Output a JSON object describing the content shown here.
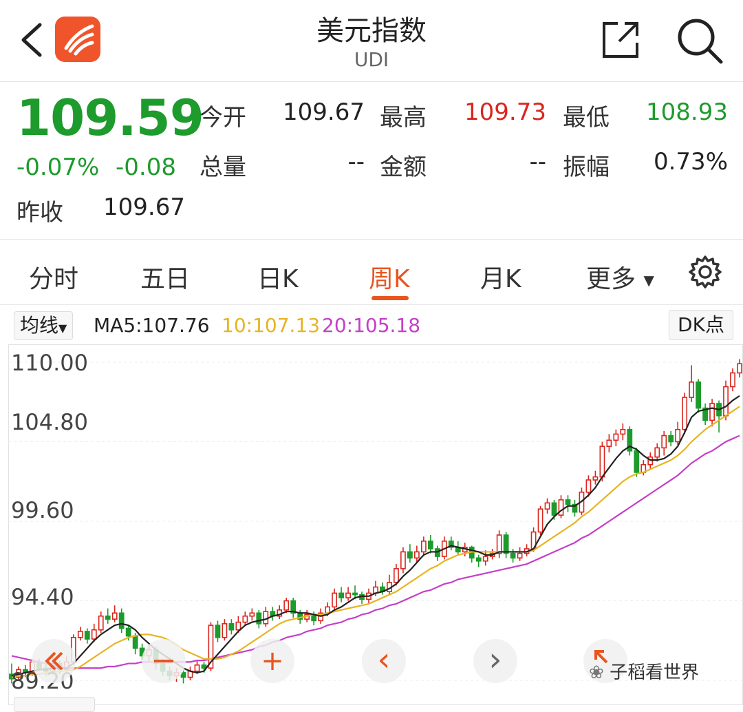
{
  "header": {
    "title": "美元指数",
    "subtitle": "UDI",
    "icons": [
      "back-icon",
      "app-logo",
      "share-icon",
      "search-icon"
    ]
  },
  "quote": {
    "price": "109.59",
    "change_pct": "-0.07%",
    "change": "-0.08",
    "prev_close_label": "昨收",
    "prev_close": "109.67",
    "open_label": "今开",
    "open": "109.67",
    "high_label": "最高",
    "high": "109.73",
    "low_label": "最低",
    "low": "108.93",
    "volume_label": "总量",
    "volume": "--",
    "amount_label": "金额",
    "amount": "--",
    "amplitude_label": "振幅",
    "amplitude": "0.73%",
    "colors": {
      "down": "#1d9b2c",
      "up": "#d9251d"
    }
  },
  "tabs": {
    "items": [
      "分时",
      "五日",
      "日K",
      "周K",
      "月K",
      "更多"
    ],
    "active": "周K"
  },
  "ma": {
    "selector_label": "均线",
    "ma5": "MA5:107.76",
    "ma10": "10:107.13",
    "ma20": "20:105.18",
    "dk_button": "DK点",
    "colors": {
      "ma5": "#222222",
      "ma10": "#e6b422",
      "ma20": "#c43fc7"
    }
  },
  "chart_data": {
    "type": "candlestick",
    "yticks": [
      "110.00",
      "104.80",
      "99.60",
      "94.40",
      "89.20"
    ],
    "ylim": [
      89.2,
      110.0
    ],
    "candles": [
      [
        89.6,
        89.3,
        90.3,
        89.0
      ],
      [
        89.4,
        89.9,
        90.1,
        89.2
      ],
      [
        89.9,
        89.7,
        90.2,
        89.4
      ],
      [
        89.7,
        90.4,
        90.6,
        89.5
      ],
      [
        90.4,
        90.0,
        90.6,
        89.8
      ],
      [
        90.0,
        89.8,
        90.3,
        89.5
      ],
      [
        89.8,
        90.3,
        90.7,
        89.6
      ],
      [
        90.3,
        89.9,
        90.5,
        89.6
      ],
      [
        89.9,
        90.4,
        90.8,
        89.7
      ],
      [
        90.4,
        92.0,
        92.2,
        90.2
      ],
      [
        92.0,
        92.4,
        92.7,
        91.8
      ],
      [
        92.4,
        91.9,
        92.6,
        91.6
      ],
      [
        91.9,
        92.5,
        92.9,
        91.7
      ],
      [
        92.5,
        93.4,
        93.7,
        92.3
      ],
      [
        93.4,
        93.2,
        93.9,
        92.9
      ],
      [
        93.2,
        93.6,
        94.1,
        93.0
      ],
      [
        93.6,
        92.6,
        93.9,
        92.3
      ],
      [
        92.6,
        92.1,
        92.8,
        91.8
      ],
      [
        92.1,
        91.3,
        92.3,
        90.9
      ],
      [
        91.3,
        90.8,
        91.6,
        90.5
      ],
      [
        90.8,
        91.2,
        91.5,
        90.4
      ],
      [
        91.2,
        90.3,
        91.4,
        89.9
      ],
      [
        90.3,
        89.8,
        90.6,
        89.5
      ],
      [
        89.8,
        89.5,
        90.1,
        89.2
      ],
      [
        89.5,
        89.7,
        90.0,
        89.1
      ],
      [
        89.7,
        89.4,
        89.9,
        89.0
      ],
      [
        89.4,
        89.8,
        90.1,
        89.2
      ],
      [
        89.8,
        90.2,
        90.5,
        89.6
      ],
      [
        90.2,
        90.0,
        90.4,
        89.7
      ],
      [
        90.0,
        92.8,
        93.0,
        89.8
      ],
      [
        92.8,
        92.0,
        93.1,
        91.7
      ],
      [
        92.0,
        92.9,
        93.2,
        91.8
      ],
      [
        92.9,
        92.5,
        93.2,
        92.2
      ],
      [
        92.5,
        93.0,
        93.4,
        92.3
      ],
      [
        93.0,
        93.4,
        93.7,
        92.8
      ],
      [
        93.4,
        93.6,
        93.9,
        93.1
      ],
      [
        93.6,
        92.9,
        93.8,
        92.6
      ],
      [
        92.9,
        93.7,
        94.0,
        92.7
      ],
      [
        93.7,
        93.4,
        94.0,
        93.1
      ],
      [
        93.4,
        93.8,
        94.1,
        93.2
      ],
      [
        93.8,
        94.4,
        94.6,
        93.6
      ],
      [
        94.4,
        93.6,
        94.6,
        93.3
      ],
      [
        93.6,
        93.2,
        93.8,
        92.9
      ],
      [
        93.2,
        93.5,
        93.8,
        93.0
      ],
      [
        93.5,
        93.1,
        93.7,
        92.8
      ],
      [
        93.1,
        93.6,
        93.9,
        92.9
      ],
      [
        93.6,
        94.0,
        94.3,
        93.4
      ],
      [
        94.0,
        94.9,
        95.2,
        93.8
      ],
      [
        94.9,
        94.6,
        95.3,
        94.3
      ],
      [
        94.6,
        94.9,
        95.3,
        94.4
      ],
      [
        94.9,
        94.8,
        95.4,
        94.5
      ],
      [
        94.8,
        94.5,
        95.0,
        94.2
      ],
      [
        94.5,
        94.9,
        95.2,
        94.2
      ],
      [
        94.9,
        95.3,
        95.7,
        94.7
      ],
      [
        95.3,
        95.0,
        95.6,
        94.8
      ],
      [
        95.0,
        95.6,
        96.1,
        94.8
      ],
      [
        95.6,
        96.5,
        96.8,
        95.4
      ],
      [
        96.5,
        97.6,
        97.9,
        96.2
      ],
      [
        97.6,
        97.2,
        98.1,
        96.9
      ],
      [
        97.2,
        97.6,
        98.0,
        96.9
      ],
      [
        97.6,
        98.3,
        98.6,
        97.3
      ],
      [
        98.3,
        97.8,
        98.7,
        97.5
      ],
      [
        97.8,
        97.3,
        98.0,
        97.0
      ],
      [
        97.3,
        98.3,
        98.6,
        97.1
      ],
      [
        98.3,
        97.9,
        98.6,
        97.7
      ],
      [
        97.9,
        97.6,
        98.3,
        97.4
      ],
      [
        97.6,
        97.9,
        98.2,
        97.3
      ],
      [
        97.9,
        97.2,
        98.0,
        96.9
      ],
      [
        97.2,
        97.0,
        97.4,
        96.6
      ],
      [
        97.0,
        97.3,
        97.7,
        96.7
      ],
      [
        97.3,
        97.5,
        97.8,
        97.1
      ],
      [
        97.5,
        98.7,
        99.0,
        97.2
      ],
      [
        98.7,
        97.5,
        98.9,
        97.2
      ],
      [
        97.5,
        97.2,
        97.8,
        96.9
      ],
      [
        97.2,
        97.5,
        97.9,
        97.0
      ],
      [
        97.5,
        97.8,
        98.1,
        97.3
      ],
      [
        97.8,
        98.9,
        99.2,
        97.6
      ],
      [
        98.9,
        100.4,
        100.6,
        98.7
      ],
      [
        100.4,
        100.8,
        101.1,
        100.1
      ],
      [
        100.8,
        100.0,
        101.0,
        99.7
      ],
      [
        100.0,
        101.0,
        101.3,
        99.8
      ],
      [
        101.0,
        100.7,
        101.3,
        100.2
      ],
      [
        100.7,
        100.2,
        101.0,
        99.9
      ],
      [
        100.2,
        101.5,
        101.8,
        100.0
      ],
      [
        101.5,
        102.3,
        102.6,
        101.2
      ],
      [
        102.3,
        102.5,
        102.9,
        102.0
      ],
      [
        102.5,
        104.5,
        104.8,
        102.2
      ],
      [
        104.5,
        104.9,
        105.3,
        104.1
      ],
      [
        104.9,
        105.3,
        105.6,
        104.5
      ],
      [
        105.3,
        105.6,
        106.0,
        104.9
      ],
      [
        105.6,
        104.2,
        105.8,
        103.9
      ],
      [
        104.2,
        102.8,
        104.4,
        102.5
      ],
      [
        102.8,
        103.3,
        103.6,
        102.6
      ],
      [
        103.3,
        103.8,
        104.1,
        103.0
      ],
      [
        103.8,
        104.4,
        104.7,
        103.5
      ],
      [
        104.4,
        105.2,
        105.5,
        103.9
      ],
      [
        105.2,
        104.8,
        105.5,
        104.5
      ],
      [
        104.8,
        105.6,
        106.1,
        104.6
      ],
      [
        105.6,
        107.7,
        108.0,
        105.3
      ],
      [
        107.7,
        108.7,
        109.8,
        107.4
      ],
      [
        108.7,
        107.0,
        108.9,
        106.7
      ],
      [
        107.0,
        106.2,
        107.3,
        105.9
      ],
      [
        106.2,
        107.3,
        107.6,
        105.8
      ],
      [
        107.3,
        106.5,
        107.5,
        105.4
      ],
      [
        106.5,
        108.4,
        108.8,
        106.2
      ],
      [
        108.4,
        109.3,
        109.6,
        108.1
      ],
      [
        109.3,
        109.9,
        110.2,
        109.0
      ]
    ],
    "ma5": [
      89.5,
      89.6,
      89.7,
      89.8,
      89.9,
      89.9,
      90.0,
      90.0,
      90.0,
      90.3,
      90.8,
      91.3,
      91.8,
      92.2,
      92.5,
      92.8,
      92.9,
      92.8,
      92.5,
      92.0,
      91.6,
      91.2,
      90.9,
      90.6,
      90.3,
      90.0,
      89.8,
      89.7,
      89.8,
      90.4,
      90.9,
      91.4,
      91.9,
      92.4,
      92.8,
      93.0,
      93.1,
      93.2,
      93.4,
      93.5,
      93.7,
      93.7,
      93.6,
      93.6,
      93.5,
      93.4,
      93.5,
      93.8,
      94.0,
      94.3,
      94.6,
      94.7,
      94.7,
      94.9,
      95.0,
      95.2,
      95.5,
      96.0,
      96.4,
      96.9,
      97.4,
      97.6,
      97.6,
      97.8,
      98.0,
      97.9,
      97.8,
      97.7,
      97.6,
      97.4,
      97.4,
      97.6,
      97.6,
      97.6,
      97.6,
      97.6,
      97.8,
      98.6,
      99.4,
      99.9,
      100.3,
      100.6,
      100.6,
      100.9,
      101.3,
      101.8,
      102.5,
      103.1,
      103.7,
      104.2,
      104.5,
      104.3,
      103.9,
      103.6,
      103.6,
      103.7,
      104.0,
      104.5,
      105.4,
      106.4,
      106.8,
      106.9,
      107.0,
      106.9,
      107.1,
      107.5,
      107.8
    ],
    "ma10": [
      89.4,
      89.5,
      89.5,
      89.6,
      89.6,
      89.7,
      89.7,
      89.8,
      89.8,
      89.9,
      90.1,
      90.4,
      90.7,
      91.0,
      91.3,
      91.6,
      91.8,
      92.0,
      92.1,
      92.2,
      92.2,
      92.1,
      92.0,
      91.8,
      91.5,
      91.2,
      91.0,
      90.8,
      90.6,
      90.6,
      90.6,
      90.7,
      90.9,
      91.1,
      91.4,
      91.7,
      92.0,
      92.3,
      92.6,
      92.9,
      93.1,
      93.2,
      93.3,
      93.4,
      93.5,
      93.5,
      93.6,
      93.7,
      93.8,
      93.9,
      94.0,
      94.1,
      94.2,
      94.4,
      94.6,
      94.8,
      95.0,
      95.3,
      95.6,
      95.9,
      96.2,
      96.5,
      96.7,
      97.0,
      97.2,
      97.4,
      97.5,
      97.6,
      97.6,
      97.6,
      97.6,
      97.6,
      97.6,
      97.6,
      97.6,
      97.6,
      97.7,
      98.0,
      98.3,
      98.6,
      98.9,
      99.2,
      99.5,
      99.9,
      100.2,
      100.6,
      101.0,
      101.4,
      101.8,
      102.2,
      102.5,
      102.7,
      102.8,
      103.0,
      103.2,
      103.4,
      103.6,
      103.9,
      104.3,
      104.8,
      105.2,
      105.6,
      105.9,
      106.2,
      106.5,
      106.8,
      107.1
    ],
    "ma20": [
      90.8,
      90.7,
      90.6,
      90.5,
      90.4,
      90.3,
      90.2,
      90.1,
      90.0,
      90.0,
      90.0,
      90.0,
      90.0,
      90.0,
      90.1,
      90.1,
      90.2,
      90.3,
      90.3,
      90.4,
      90.4,
      90.4,
      90.4,
      90.4,
      90.4,
      90.4,
      90.4,
      90.5,
      90.5,
      90.6,
      90.7,
      90.8,
      90.9,
      91.0,
      91.1,
      91.2,
      91.4,
      91.5,
      91.7,
      91.8,
      92.0,
      92.1,
      92.2,
      92.4,
      92.5,
      92.6,
      92.8,
      92.9,
      93.0,
      93.2,
      93.3,
      93.5,
      93.6,
      93.8,
      93.9,
      94.1,
      94.2,
      94.4,
      94.6,
      94.8,
      95.0,
      95.1,
      95.3,
      95.5,
      95.6,
      95.8,
      95.9,
      96.0,
      96.1,
      96.2,
      96.3,
      96.4,
      96.5,
      96.6,
      96.7,
      96.8,
      97.0,
      97.2,
      97.4,
      97.6,
      97.8,
      98.0,
      98.2,
      98.5,
      98.7,
      99.0,
      99.3,
      99.6,
      99.9,
      100.2,
      100.5,
      100.8,
      101.1,
      101.4,
      101.7,
      102.0,
      102.3,
      102.6,
      103.0,
      103.4,
      103.7,
      104.0,
      104.2,
      104.5,
      104.8,
      105.0,
      105.2
    ]
  },
  "controls": {
    "zoom_in": "+",
    "prev": "‹",
    "next": "›"
  },
  "watermark": "子稻看世界"
}
